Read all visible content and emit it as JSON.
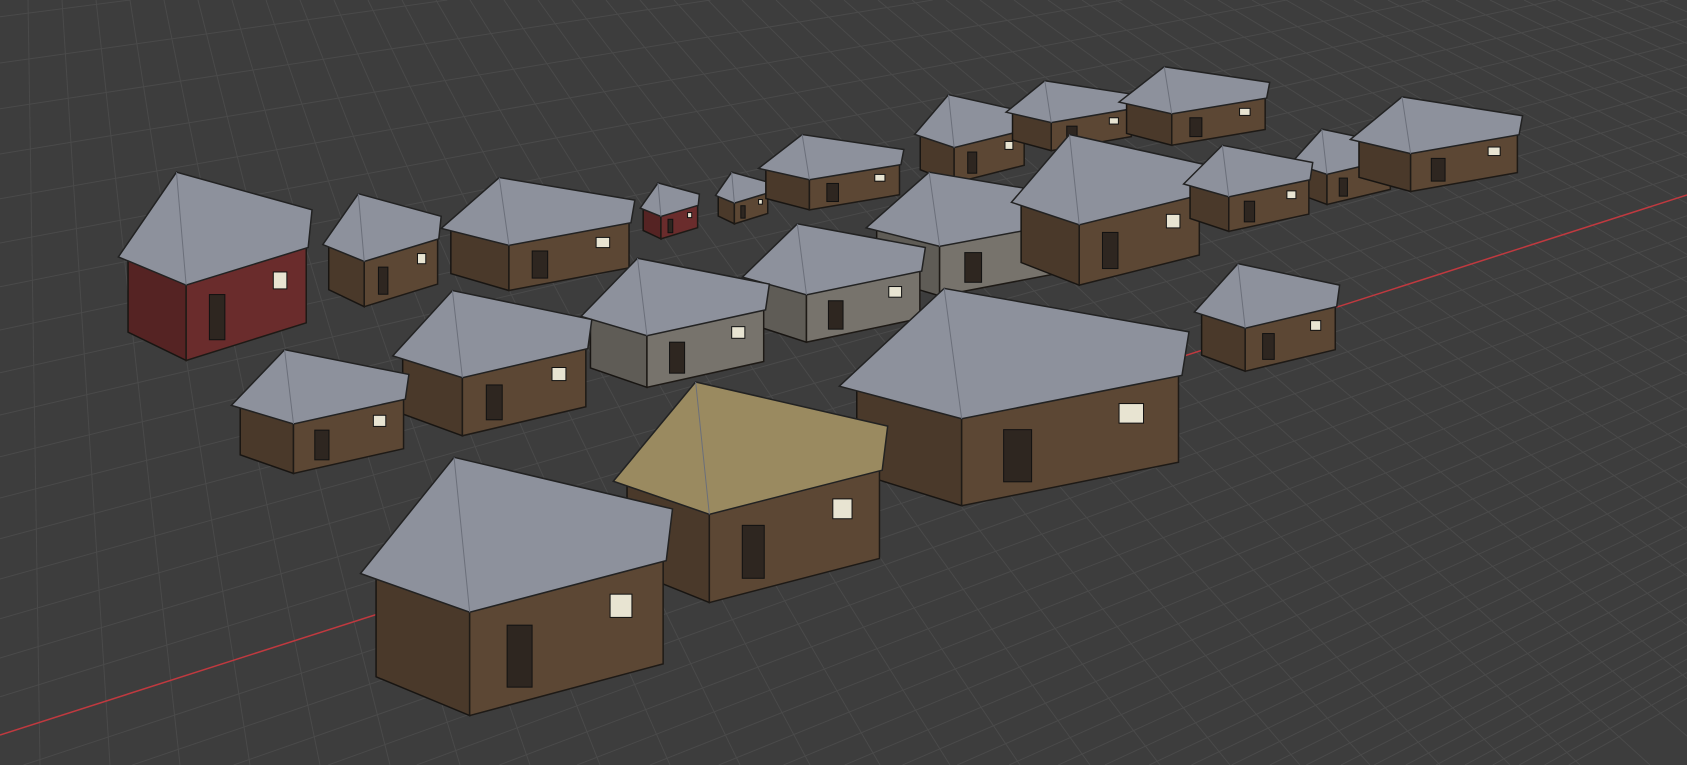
{
  "scene": {
    "background_color": "#3d3d3d",
    "grid_color": "#4a4a4a",
    "x_axis_color": "#c0393f",
    "roof_color": "#8d919c",
    "wall_color": "#5c4734",
    "red_wall_color": "#6a2c2c",
    "thatch_color": "#9a8a60"
  }
}
